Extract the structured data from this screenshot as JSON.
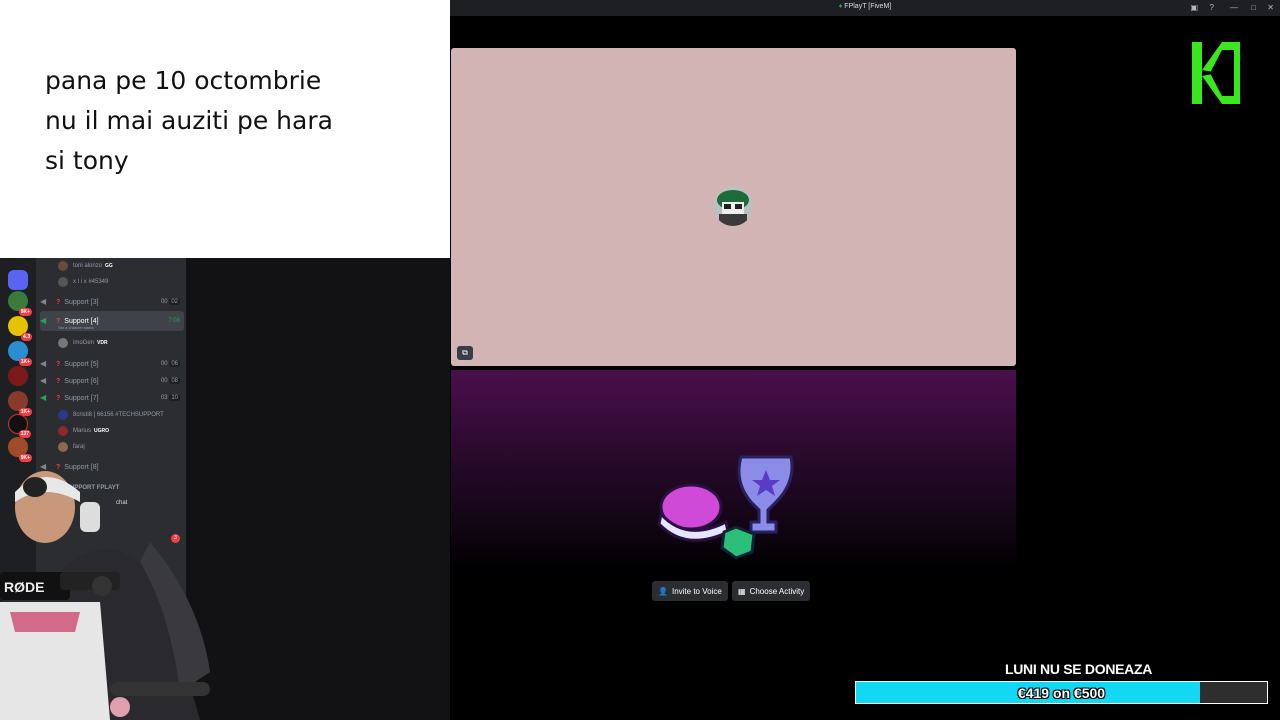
{
  "overlay_note": {
    "line1": "pana pe 10 octombrie",
    "line2": "nu il mai auziti pe hara",
    "line3": "si tony"
  },
  "window": {
    "title": "FPlayT [FiveM]"
  },
  "server_badges": [
    "9K+",
    "4.3",
    "1K+",
    "1K+",
    "137",
    "9K+"
  ],
  "channels": {
    "member_top_1": "toni alonzo",
    "member_top_1_tag": "GG",
    "member_top_2": "x l i x #45349",
    "support3": {
      "name": "Support [3]",
      "count_a": "00",
      "count_b": "02"
    },
    "support4": {
      "name": "Support [4]",
      "status": "Set a channel status",
      "time": "7:08"
    },
    "support4_member": "imoGen",
    "support4_member_tag": "VDR",
    "support5": {
      "name": "Support [5]",
      "count_a": "00",
      "count_b": "06"
    },
    "support6": {
      "name": "Support [6]",
      "count_a": "00",
      "count_b": "08"
    },
    "support7": {
      "name": "Support [7]",
      "count_a": "03",
      "count_b": "10"
    },
    "support7_member1": "8cristi8 | 66156 #TECHSUPPORT",
    "support7_member2": "Marius",
    "support7_member2_tag": "UGRO",
    "support7_member3": "faraj",
    "support8": {
      "name": "Support [8]"
    },
    "category": "SUPPORT FPLAYT",
    "text_channel": "chat",
    "unread_count": "3"
  },
  "voice": {
    "invite_label": "Invite to Voice",
    "activity_label": "Choose Activity"
  },
  "donation": {
    "title": "LUNI NU SE DONEAZA",
    "label": "€419 on €500",
    "current": 419,
    "goal": 500,
    "fill_color": "#12d8f3"
  },
  "colors": {
    "accent_green": "#23a559",
    "logo_green": "#39e81c",
    "tile_bg": "#d2b4b4"
  }
}
